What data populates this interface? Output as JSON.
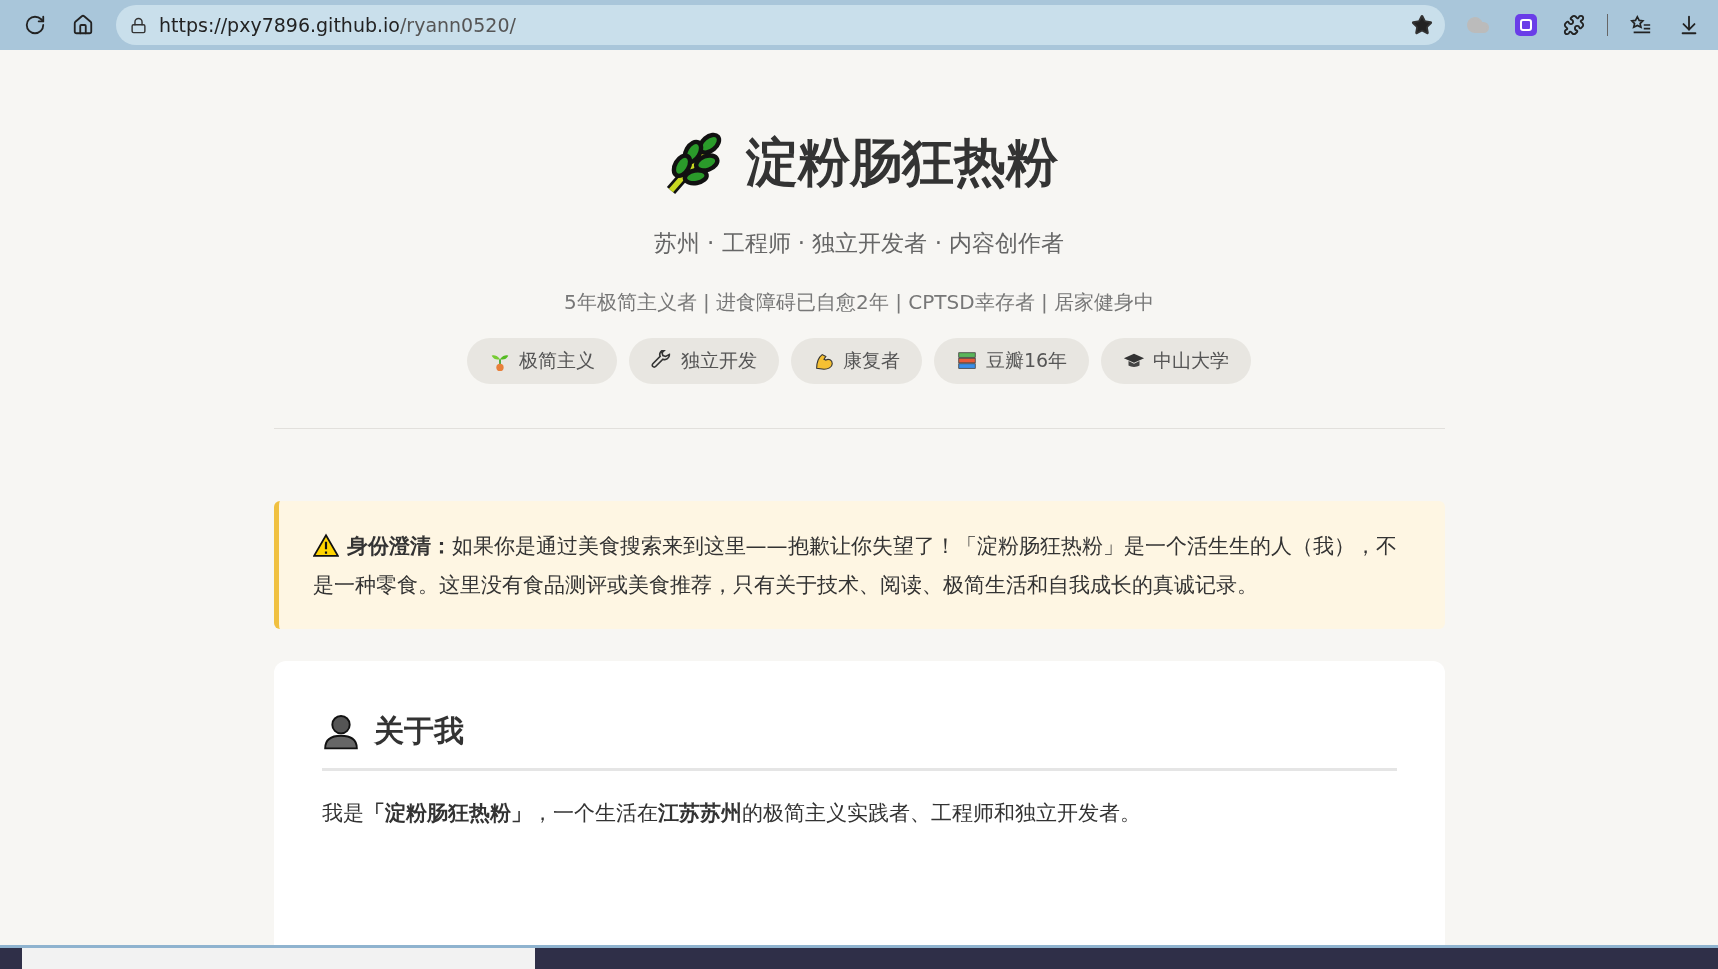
{
  "browser": {
    "url_host": "https://pxy7896.github.io",
    "url_path": "/ryann0520/"
  },
  "header": {
    "title": "淀粉肠狂热粉",
    "subtitle": "苏州 · 工程师 · 独立开发者 · 内容创作者",
    "tagline": "5年极简主义者 | 进食障碍已自愈2年 | CPTSD幸存者 | 居家健身中",
    "tags": [
      {
        "kind": "sprout",
        "label": "极简主义"
      },
      {
        "kind": "wrench",
        "label": "独立开发"
      },
      {
        "kind": "arm",
        "label": "康复者"
      },
      {
        "kind": "books",
        "label": "豆瓣16年"
      },
      {
        "kind": "cap",
        "label": "中山大学"
      }
    ]
  },
  "notice": {
    "text": "**身份澄清：**如果你是通过美食搜索来到这里——抱歉让你失望了！「淀粉肠狂热粉」是一个活生生的人（我），不是一种零食。这里没有食品测评或美食推荐，只有关于技术、阅读、极简生活和自我成长的真诚记录。"
  },
  "about": {
    "title": "关于我",
    "text": "我是**「淀粉肠狂热粉」**，一个生活在**江苏苏州**的极简主义实践者、工程师和独立开发者。"
  }
}
